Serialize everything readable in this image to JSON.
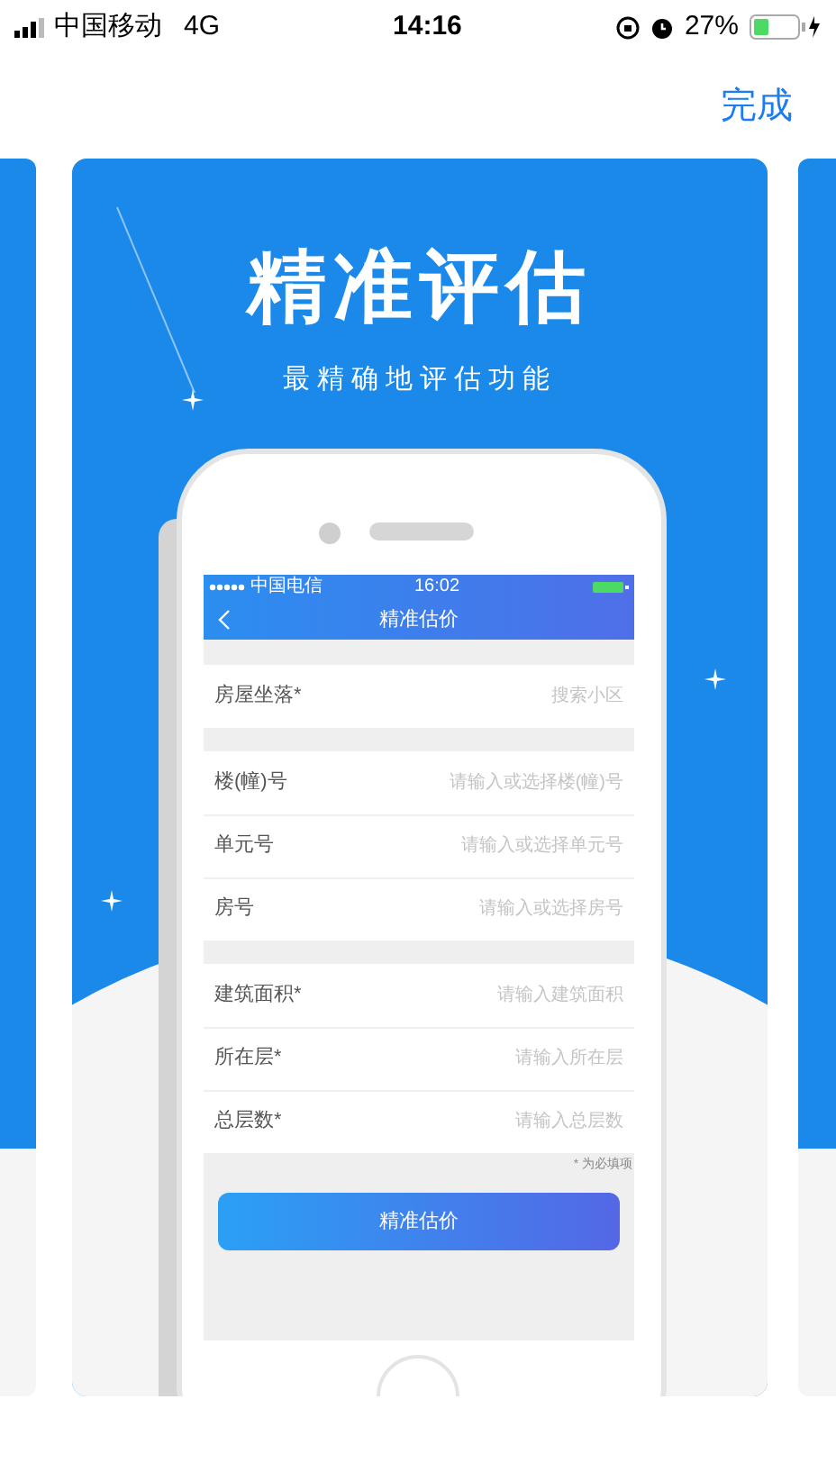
{
  "status_bar": {
    "carrier": "中国移动",
    "network": "4G",
    "time": "14:16",
    "battery": "27%"
  },
  "nav": {
    "done": "完成"
  },
  "card": {
    "title": "精准评估",
    "subtitle": "最精确地评估功能",
    "phone": {
      "status_bar": {
        "carrier": "中国电信",
        "time": "16:02"
      },
      "title": "精准估价",
      "sections": [
        [
          {
            "label": "房屋坐落*",
            "placeholder": "搜索小区"
          }
        ],
        [
          {
            "label": "楼(幢)号",
            "placeholder": "请输入或选择楼(幢)号"
          },
          {
            "label": "单元号",
            "placeholder": "请输入或选择单元号"
          },
          {
            "label": "房号",
            "placeholder": "请输入或选择房号"
          }
        ],
        [
          {
            "label": "建筑面积*",
            "placeholder": "请输入建筑面积"
          },
          {
            "label": "所在层*",
            "placeholder": "请输入所在层"
          },
          {
            "label": "总层数*",
            "placeholder": "请输入总层数"
          }
        ]
      ],
      "note": "* 为必填项",
      "button": "精准估价"
    }
  }
}
